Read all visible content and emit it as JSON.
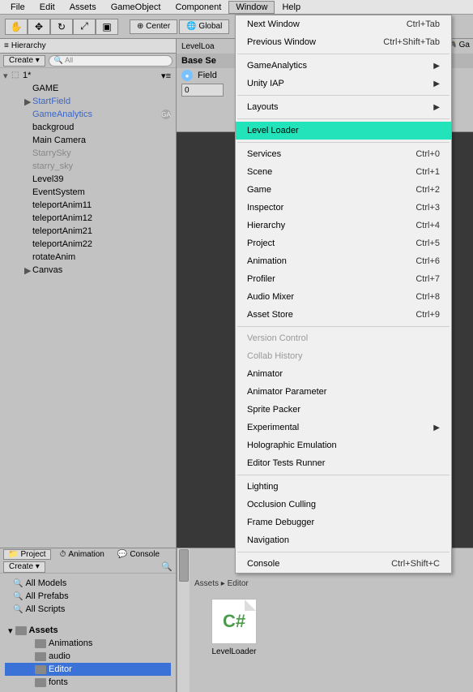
{
  "menubar": [
    "File",
    "Edit",
    "Assets",
    "GameObject",
    "Component",
    "Window",
    "Help"
  ],
  "menubar_active_index": 5,
  "toolbar": {
    "center": "Center",
    "global": "Global"
  },
  "hierarchy": {
    "tab": "Hierarchy",
    "menu_icon": "≡",
    "create": "Create",
    "search_placeholder": "All",
    "root": "1*",
    "items": [
      {
        "label": "GAME",
        "style": "",
        "indent": 1
      },
      {
        "label": "StartField",
        "style": "blue",
        "indent": 1,
        "toggle": "▶"
      },
      {
        "label": "GameAnalytics",
        "style": "blue",
        "indent": 1,
        "badge": "GA"
      },
      {
        "label": "backgroud",
        "style": "",
        "indent": 1
      },
      {
        "label": "Main Camera",
        "style": "",
        "indent": 1
      },
      {
        "label": "StarrySky",
        "style": "grey",
        "indent": 1
      },
      {
        "label": "starry_sky",
        "style": "grey",
        "indent": 1
      },
      {
        "label": "Level39",
        "style": "",
        "indent": 1
      },
      {
        "label": "EventSystem",
        "style": "",
        "indent": 1
      },
      {
        "label": "teleportAnim11",
        "style": "",
        "indent": 1
      },
      {
        "label": "teleportAnim12",
        "style": "",
        "indent": 1
      },
      {
        "label": "teleportAnim21",
        "style": "",
        "indent": 1
      },
      {
        "label": "teleportAnim22",
        "style": "",
        "indent": 1
      },
      {
        "label": "rotateAnim",
        "style": "",
        "indent": 1
      },
      {
        "label": "Canvas",
        "style": "",
        "indent": 1,
        "toggle": "▶"
      }
    ]
  },
  "inspector_peek": {
    "tab": "LevelLoa",
    "section": "Base Se",
    "field_label": "Field",
    "field_value": "0",
    "scene_tab": "Ga"
  },
  "dropdown": {
    "groups": [
      [
        {
          "label": "Next Window",
          "shortcut": "Ctrl+Tab"
        },
        {
          "label": "Previous Window",
          "shortcut": "Ctrl+Shift+Tab"
        }
      ],
      [
        {
          "label": "GameAnalytics",
          "submenu": true
        },
        {
          "label": "Unity IAP",
          "submenu": true
        }
      ],
      [
        {
          "label": "Layouts",
          "submenu": true
        }
      ],
      [
        {
          "label": "Level Loader",
          "highlight": true
        }
      ],
      [
        {
          "label": "Services",
          "shortcut": "Ctrl+0"
        },
        {
          "label": "Scene",
          "shortcut": "Ctrl+1"
        },
        {
          "label": "Game",
          "shortcut": "Ctrl+2"
        },
        {
          "label": "Inspector",
          "shortcut": "Ctrl+3"
        },
        {
          "label": "Hierarchy",
          "shortcut": "Ctrl+4"
        },
        {
          "label": "Project",
          "shortcut": "Ctrl+5"
        },
        {
          "label": "Animation",
          "shortcut": "Ctrl+6"
        },
        {
          "label": "Profiler",
          "shortcut": "Ctrl+7"
        },
        {
          "label": "Audio Mixer",
          "shortcut": "Ctrl+8"
        },
        {
          "label": "Asset Store",
          "shortcut": "Ctrl+9"
        }
      ],
      [
        {
          "label": "Version Control",
          "disabled": true
        },
        {
          "label": "Collab History",
          "disabled": true
        },
        {
          "label": "Animator"
        },
        {
          "label": "Animator Parameter"
        },
        {
          "label": "Sprite Packer"
        },
        {
          "label": "Experimental",
          "submenu": true
        },
        {
          "label": "Holographic Emulation"
        },
        {
          "label": "Editor Tests Runner"
        }
      ],
      [
        {
          "label": "Lighting"
        },
        {
          "label": "Occlusion Culling"
        },
        {
          "label": "Frame Debugger"
        },
        {
          "label": "Navigation"
        }
      ],
      [
        {
          "label": "Console",
          "shortcut": "Ctrl+Shift+C"
        }
      ]
    ]
  },
  "project": {
    "tabs": [
      "Project",
      "Animation",
      "Console"
    ],
    "create": "Create",
    "favorites": [
      "All Models",
      "All Prefabs",
      "All Scripts"
    ],
    "assets_label": "Assets",
    "folders": [
      "Animations",
      "audio",
      "Editor",
      "fonts"
    ],
    "selected_folder_index": 2,
    "breadcrumb": "Assets ▸ Editor",
    "asset": {
      "name": "LevelLoader",
      "icon": "C#"
    }
  }
}
